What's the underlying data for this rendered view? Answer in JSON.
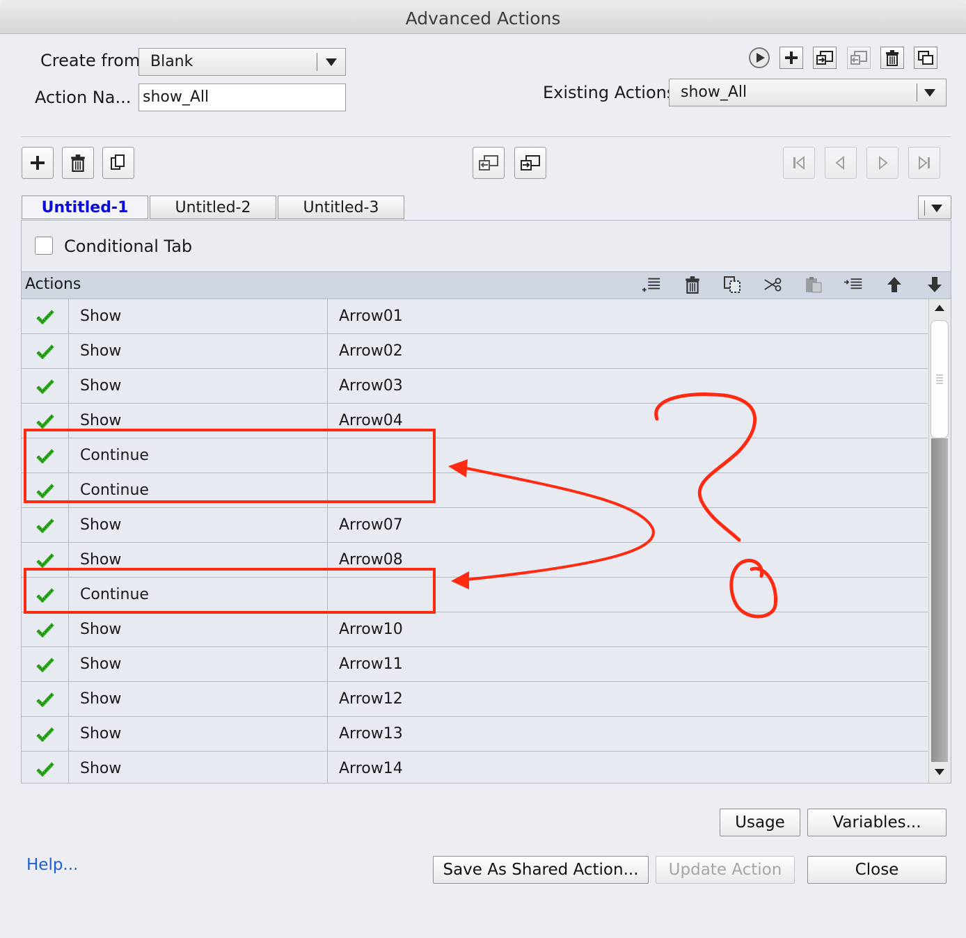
{
  "window": {
    "title": "Advanced Actions"
  },
  "form": {
    "create_from_label": "Create from:",
    "create_from_value": "Blank",
    "action_name_label": "Action Na...",
    "action_name_value": "show_All",
    "existing_actions_label": "Existing Actions:",
    "existing_actions_value": "show_All"
  },
  "tabs": [
    {
      "label": "Untitled-1",
      "active": true
    },
    {
      "label": "Untitled-2",
      "active": false
    },
    {
      "label": "Untitled-3",
      "active": false
    }
  ],
  "conditional_tab": {
    "label": "Conditional Tab",
    "checked": false
  },
  "actions_panel": {
    "header": "Actions"
  },
  "rows": [
    {
      "action": "Show",
      "target": "Arrow01"
    },
    {
      "action": "Show",
      "target": "Arrow02"
    },
    {
      "action": "Show",
      "target": "Arrow03"
    },
    {
      "action": "Show",
      "target": "Arrow04"
    },
    {
      "action": "Continue",
      "target": ""
    },
    {
      "action": "Continue",
      "target": ""
    },
    {
      "action": "Show",
      "target": "Arrow07"
    },
    {
      "action": "Show",
      "target": "Arrow08"
    },
    {
      "action": "Continue",
      "target": ""
    },
    {
      "action": "Show",
      "target": "Arrow10"
    },
    {
      "action": "Show",
      "target": "Arrow11"
    },
    {
      "action": "Show",
      "target": "Arrow12"
    },
    {
      "action": "Show",
      "target": "Arrow13"
    },
    {
      "action": "Show",
      "target": "Arrow14"
    }
  ],
  "buttons": {
    "usage": "Usage",
    "variables": "Variables...",
    "save_shared": "Save As Shared Action...",
    "update_action": "Update Action",
    "close": "Close"
  },
  "help_link": "Help...",
  "colors": {
    "annotation": "#ff2a12",
    "check": "#2fae1e",
    "active_tab": "#0b0bd6",
    "link": "#1d5fd1"
  }
}
